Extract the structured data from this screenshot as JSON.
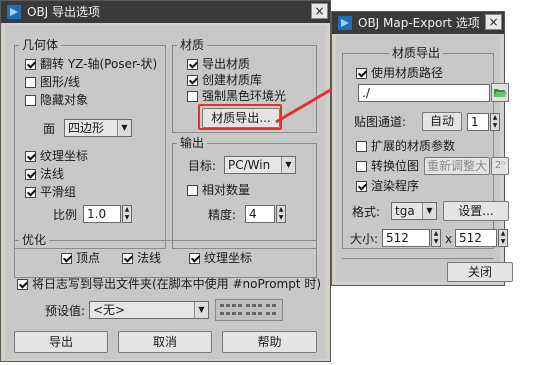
{
  "obj_export": {
    "title": "OBJ 导出选项",
    "close": "×",
    "geometry": {
      "title": "几何体",
      "flip_yz": "翻转 YZ-轴(Poser-状)",
      "shapes_lines": "图形/线",
      "hidden_objects": "隐藏对象",
      "faces_label": "面",
      "faces_value": "四边形",
      "texture_coords": "纹理坐标",
      "normals": "法线",
      "smoothing_groups": "平滑组",
      "scale_label": "比例",
      "scale_value": "1.0"
    },
    "material": {
      "title": "材质",
      "export_materials": "导出材质",
      "create_mat_lib": "创建材质库",
      "force_black_ambient": "强制黑色环境光",
      "mat_export_button": "材质导出..."
    },
    "output": {
      "title": "输出",
      "target_label": "目标:",
      "target_value": "PC/Win",
      "relative_numbers": "相对数量",
      "precision_label": "精度:",
      "precision_value": "4"
    },
    "optimize": {
      "title": "优化",
      "vertices": "顶点",
      "normals": "法线",
      "texture_coords": "纹理坐标"
    },
    "log_to_export": "将日志写到导出文件夹(在脚本中使用 #noPrompt 时)",
    "preset_label": "预设值:",
    "preset_value": "<无>",
    "buttons": {
      "export": "导出",
      "cancel": "取消",
      "help": "帮助"
    }
  },
  "mapexport": {
    "title": "OBJ Map-Export 选项",
    "close": "×",
    "group_title": "材质导出",
    "use_map_path": "使用材质路径",
    "path_value": "./",
    "map_channel_label": "贴图通道:",
    "map_channel_auto": "自动",
    "map_channel_value": "1",
    "extended_params": "扩展的材质参数",
    "convert_bitmaps": "转换位图",
    "resize_button": "重新调整大小",
    "pow2_button": "2ⁿ",
    "render_program": "渲染程序",
    "format_label": "格式:",
    "format_value": "tga",
    "settings_button": "设置...",
    "size_label": "大小:",
    "size_w": "512",
    "size_x": "x",
    "size_h": "512",
    "close_button": "关闭"
  },
  "colors": {
    "arrow": "#e53030",
    "titlebar": "#3a3a3a",
    "panel": "#c8c8c8"
  }
}
